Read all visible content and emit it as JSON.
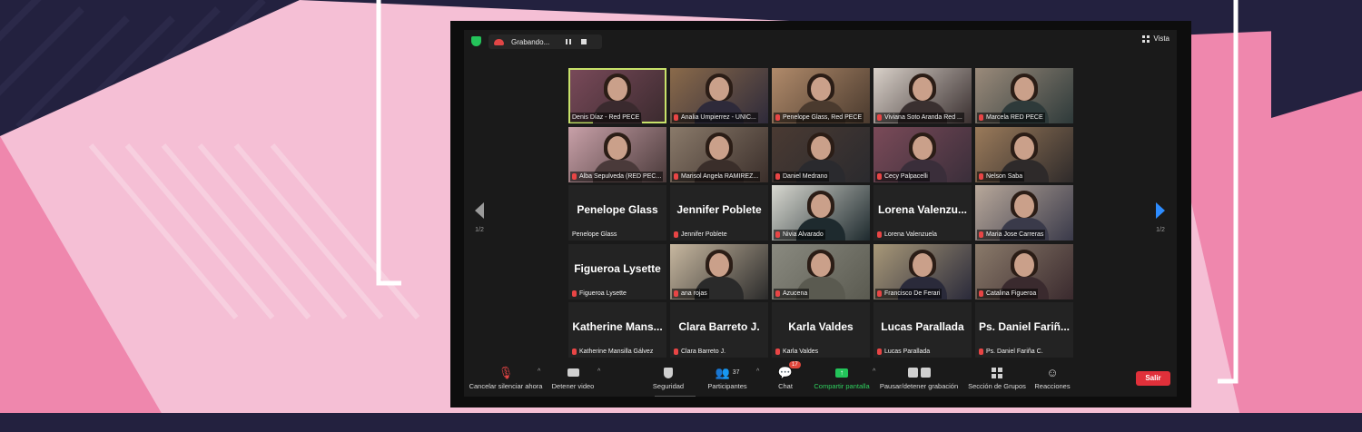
{
  "recording": {
    "label": "Grabando..."
  },
  "view": {
    "label": "Vista"
  },
  "pagination": {
    "left": "1/2",
    "right": "1/2"
  },
  "colors": {
    "accent_blue": "#2d8cff",
    "share_green": "#2fcf5e",
    "leave_red": "#e0303a",
    "active_speaker": "#c8e26a",
    "page_pink": "#f5bfd5"
  },
  "participants": [
    {
      "name": "Denis Díaz - Red PECE",
      "big": "",
      "video": true,
      "muted": false,
      "active": true
    },
    {
      "name": "Analia Umpierrez - UNIC...",
      "big": "",
      "video": true,
      "muted": true
    },
    {
      "name": "Penelope Glass, Red PECE",
      "big": "",
      "video": true,
      "muted": true
    },
    {
      "name": "Viviana Soto Aranda Red ...",
      "big": "",
      "video": true,
      "muted": true
    },
    {
      "name": "Marcela RED PECE",
      "big": "",
      "video": true,
      "muted": true
    },
    {
      "name": "Alba Sepulveda (RED PEC...",
      "big": "",
      "video": true,
      "muted": true
    },
    {
      "name": "Marisol Angela RAMIREZ...",
      "big": "",
      "video": true,
      "muted": true
    },
    {
      "name": "Daniel Medrano",
      "big": "",
      "video": true,
      "muted": true
    },
    {
      "name": "Cecy Palpacelli",
      "big": "",
      "video": true,
      "muted": true
    },
    {
      "name": "Nelson Saba",
      "big": "",
      "video": true,
      "muted": true
    },
    {
      "name": "Penelope Glass",
      "big": "Penelope Glass",
      "video": false,
      "muted": false
    },
    {
      "name": "Jennifer Poblete",
      "big": "Jennifer Poblete",
      "video": false,
      "muted": true
    },
    {
      "name": "Nivia Alvarado",
      "big": "",
      "video": true,
      "muted": true
    },
    {
      "name": "Lorena Valenzuela",
      "big": "Lorena Valenzu...",
      "video": false,
      "muted": true
    },
    {
      "name": "Maria Jose Carreras",
      "big": "",
      "video": true,
      "muted": true
    },
    {
      "name": "Figueroa Lysette",
      "big": "Figueroa Lysette",
      "video": false,
      "muted": true
    },
    {
      "name": "ana rojas",
      "big": "",
      "video": true,
      "muted": true
    },
    {
      "name": "Azucena",
      "big": "",
      "video": true,
      "muted": true
    },
    {
      "name": "Francisco De Ferari",
      "big": "",
      "video": true,
      "muted": true
    },
    {
      "name": "Catalina Figueroa",
      "big": "",
      "video": true,
      "muted": true
    },
    {
      "name": "Katherine Mansilla Gálvez",
      "big": "Katherine Mans...",
      "video": false,
      "muted": true
    },
    {
      "name": "Clara Barreto J.",
      "big": "Clara Barreto J.",
      "video": false,
      "muted": true
    },
    {
      "name": "Karla Valdes",
      "big": "Karla Valdes",
      "video": false,
      "muted": true
    },
    {
      "name": "Lucas Parallada",
      "big": "Lucas Parallada",
      "video": false,
      "muted": true
    },
    {
      "name": "Ps. Daniel Fariña C.",
      "big": "Ps. Daniel Fariñ...",
      "video": false,
      "muted": true
    }
  ],
  "toolbar": {
    "unmute": "Cancelar silenciar ahora",
    "video": "Detener video",
    "security": "Seguridad",
    "participants": "Participantes",
    "participants_count": "37",
    "chat": "Chat",
    "chat_badge": "17",
    "share": "Compartir pantalla",
    "record": "Pausar/detener grabación",
    "breakout": "Sección de Grupos",
    "reactions": "Reacciones",
    "leave": "Salir"
  }
}
